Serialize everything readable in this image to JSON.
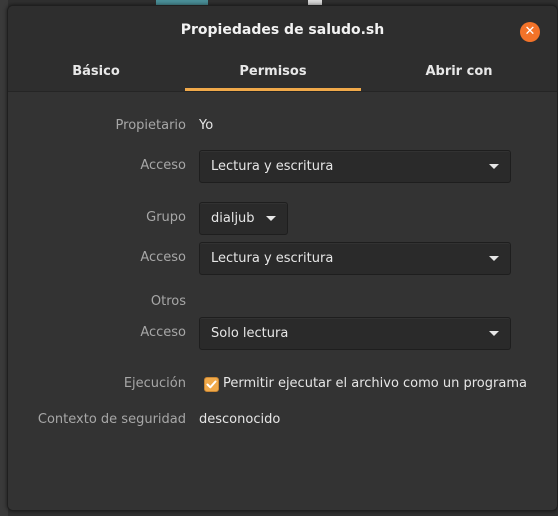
{
  "window": {
    "title": "Propiedades de saludo.sh",
    "close_symbol": "✕"
  },
  "tabs": [
    {
      "label": "Básico",
      "active": false
    },
    {
      "label": "Permisos",
      "active": true
    },
    {
      "label": "Abrir con",
      "active": false
    }
  ],
  "permissions": {
    "owner_label": "Propietario",
    "owner_value": "Yo",
    "owner_access_label": "Acceso",
    "owner_access_value": "Lectura y escritura",
    "group_label": "Grupo",
    "group_value": "dialjub",
    "group_access_label": "Acceso",
    "group_access_value": "Lectura y escritura",
    "others_label": "Otros",
    "others_access_label": "Acceso",
    "others_access_value": "Solo lectura",
    "execution_label": "Ejecución",
    "execution_checkbox_label": "Permitir ejecutar el archivo como un programa",
    "execution_checked": true,
    "security_label": "Contexto de seguridad",
    "security_value": "desconocido"
  },
  "colors": {
    "accent": "#f0a94a",
    "close_button": "#f37329"
  }
}
